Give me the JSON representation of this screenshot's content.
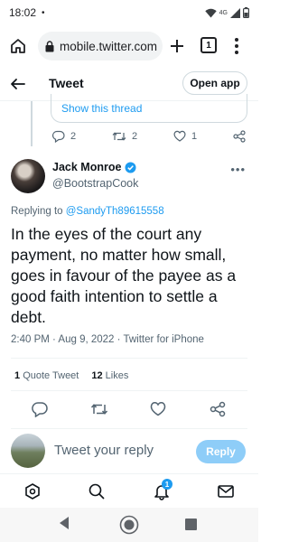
{
  "status_bar": {
    "time": "18:02",
    "dot": "•",
    "network": "4G"
  },
  "browser": {
    "url": "mobile.twitter.com",
    "tab_count": "1"
  },
  "header": {
    "title": "Tweet",
    "open_app_label": "Open app"
  },
  "previous_tweet": {
    "show_thread_label": "Show this thread",
    "reply_count": "2",
    "retweet_count": "2",
    "like_count": "1"
  },
  "tweet": {
    "author_name": "Jack Monroe",
    "author_handle": "@BootstrapCook",
    "replying_prefix": "Replying to ",
    "replying_handle": "@SandyTh89615558",
    "text": "In the eyes of the court any payment, no matter how small, goes in favour of the payee as a good faith intention to settle a debt.",
    "meta": "2:40 PM · Aug 9, 2022 · Twitter for iPhone",
    "quote_count": "1",
    "quote_label": "Quote Tweet",
    "likes_count": "12",
    "likes_label": "Likes"
  },
  "reply_box": {
    "placeholder": "Tweet your reply",
    "button_label": "Reply"
  },
  "bottom_nav": {
    "notification_badge": "1"
  },
  "colors": {
    "accent": "#1d9bf0",
    "reply_button_disabled": "#8ecdf8",
    "text_secondary": "#536471"
  }
}
